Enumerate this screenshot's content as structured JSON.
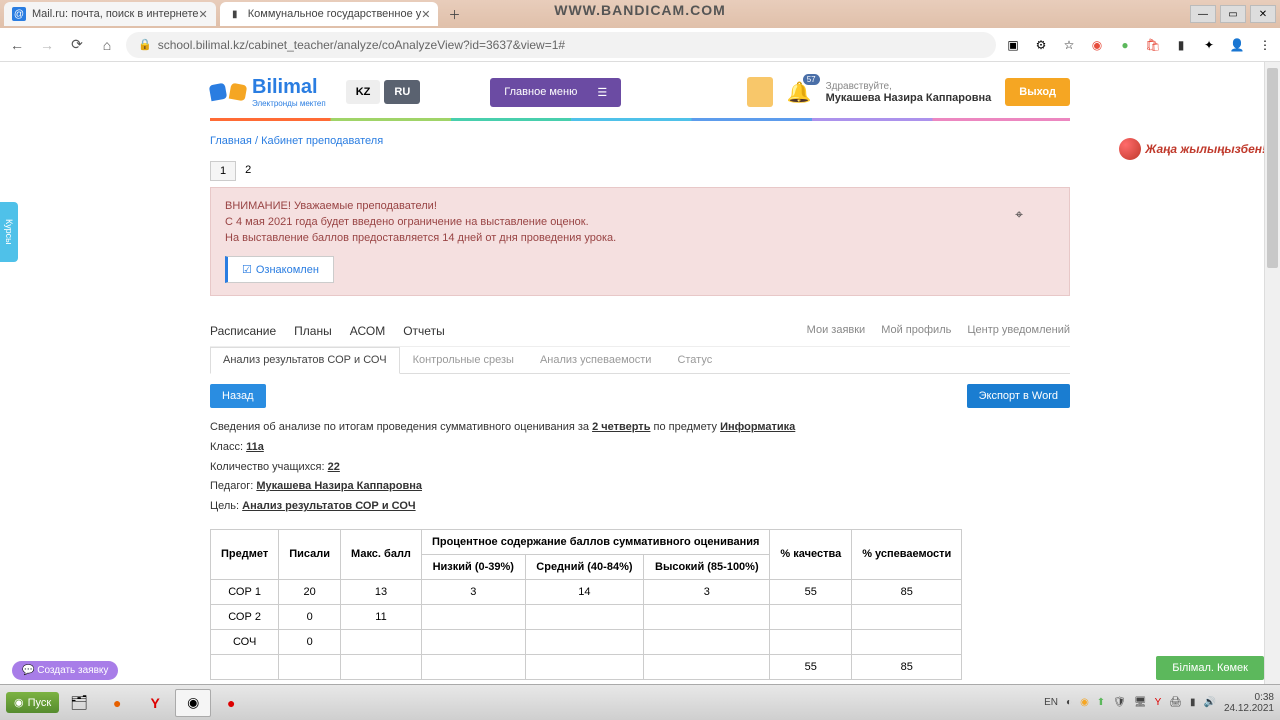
{
  "browser": {
    "tabs": [
      {
        "title": "Mail.ru: почта, поиск в интернете"
      },
      {
        "title": "Коммунальное государственное у"
      }
    ],
    "url": "school.bilimal.kz/cabinet_teacher/analyze/coAnalyzeView?id=3637&view=1#",
    "watermark": "WWW.BANDICAM.COM"
  },
  "header": {
    "brand": "Bilimal",
    "brand_sub": "Электронды мектеп",
    "lang_kz": "KZ",
    "lang_ru": "RU",
    "main_menu": "Главное меню",
    "greeting": "Здравствуйте,",
    "user": "Мукашева Назира Каппаровна",
    "logout": "Выход",
    "notif_count": "57"
  },
  "breadcrumb": {
    "home": "Главная",
    "sep": "/",
    "current": "Кабинет преподавателя"
  },
  "pager": {
    "p1": "1",
    "p2": "2"
  },
  "alert": {
    "line1": "ВНИМАНИЕ! Уважаемые преподаватели!",
    "line2": "С 4 мая 2021 года будет введено ограничение на выставление оценок.",
    "line3": "На выставление баллов предоставляется 14 дней от дня проведения урока.",
    "ack": "Ознакомлен"
  },
  "menutabs": {
    "t1": "Расписание",
    "t2": "Планы",
    "t3": "АСОМ",
    "t4": "Отчеты",
    "r1": "Мои заявки",
    "r2": "Мой профиль",
    "r3": "Центр уведомлений"
  },
  "subtabs": {
    "s1": "Анализ результатов СОР и СОЧ",
    "s2": "Контрольные срезы",
    "s3": "Анализ успеваемости",
    "s4": "Статус"
  },
  "actions": {
    "back": "Назад",
    "export": "Экспорт в Word"
  },
  "info": {
    "line_pre": "Сведения об анализе по итогам проведения суммативного оценивания за ",
    "quarter": "2 четверть",
    "subj_pre": " по предмету ",
    "subject": "Информатика",
    "class_label": "Класс: ",
    "class_val": "11а",
    "count_label": "Количество учащихся: ",
    "count_val": "22",
    "teacher_label": "Педагог: ",
    "teacher_val": "Мукашева Назира Каппаровна",
    "goal_label": "Цель: ",
    "goal_val": "Анализ результатов СОР и СОЧ"
  },
  "table": {
    "h_subject": "Предмет",
    "h_wrote": "Писали",
    "h_max": "Макс. балл",
    "h_percent": "Процентное содержание баллов суммативного оценивания",
    "h_quality": "% качества",
    "h_progress": "% успеваемости",
    "h_low": "Низкий (0-39%)",
    "h_mid": "Средний (40-84%)",
    "h_high": "Высокий (85-100%)",
    "rows": [
      {
        "n": "СОР 1",
        "w": "20",
        "m": "13",
        "lo": "3",
        "mi": "14",
        "hi": "3",
        "q": "55",
        "p": "85"
      },
      {
        "n": "СОР 2",
        "w": "0",
        "m": "11",
        "lo": "",
        "mi": "",
        "hi": "",
        "q": "",
        "p": ""
      },
      {
        "n": "СОЧ",
        "w": "0",
        "m": "",
        "lo": "",
        "mi": "",
        "hi": "",
        "q": "",
        "p": ""
      },
      {
        "n": "",
        "w": "",
        "m": "",
        "lo": "",
        "mi": "",
        "hi": "",
        "q": "55",
        "p": "85"
      }
    ]
  },
  "widgets": {
    "side": "Курсы",
    "create": "Создать заявку",
    "help": "Білімал. Көмек",
    "ny": "Жаңа жылыңызбен!"
  },
  "taskbar": {
    "start": "Пуск",
    "lang": "EN",
    "time": "0:38",
    "date": "24.12.2021"
  }
}
